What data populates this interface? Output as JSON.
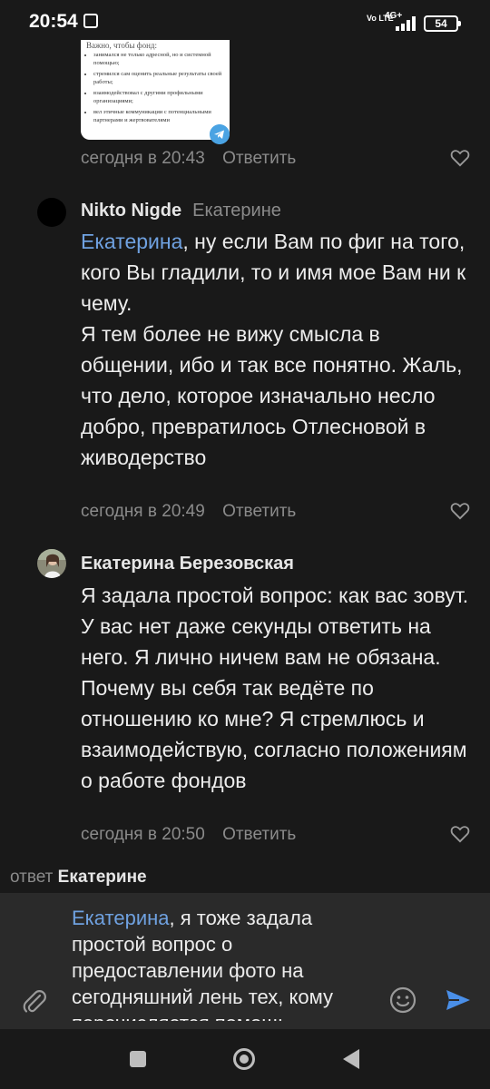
{
  "status": {
    "time": "20:54",
    "network": "4G+",
    "volte": "Vo LTE",
    "battery": "54"
  },
  "attachment": {
    "header": "Важно, чтобы фонд:",
    "bullets": [
      "занимался не только адресной, но и системной помощью;",
      "стремился сам оценить реальные результаты своей работы;",
      "взаимодействовал с другими профильными организациями;",
      "вел этичные коммуникации с потенциальными партнерами и жертвователями"
    ]
  },
  "comments": [
    {
      "timestamp": "сегодня в 20:43",
      "reply_label": "Ответить"
    },
    {
      "author": "Nikto Nigde",
      "addressee": "Екатерине",
      "mention": "Екатерина",
      "text_after_mention": ", ну если Вам по фиг на того, кого Вы гладили, то и имя мое Вам ни к чему.",
      "text": "Я тем более не вижу смысла в общении, ибо и так все понятно. Жаль, что дело, которое изначально несло добро, превратилось Отлесновой в живодерство",
      "timestamp": "сегодня в 20:49",
      "reply_label": "Ответить"
    },
    {
      "author": "Екатерина Березовская",
      "text": "Я задала простой вопрос: как вас зовут. У вас нет даже секунды ответить на него. Я лично ничем вам не обязана. Почему вы себя так ведёте по отношению ко мне? Я стремлюсь и взаимодействую, согласно положениям о работе фондов",
      "timestamp": "сегодня в 20:50",
      "reply_label": "Ответить"
    }
  ],
  "composer": {
    "reply_prefix": "ответ",
    "reply_to": "Екатерине",
    "draft_mention": "Екатерина",
    "draft_text": ", я тоже задала простой вопрос о предоставлении фото на сегодняшний лень тех, кому перечисляется помощь"
  },
  "colors": {
    "background": "#191919",
    "accent": "#6fa1e0",
    "send": "#4a8fe8",
    "muted": "#8b8b8b"
  }
}
